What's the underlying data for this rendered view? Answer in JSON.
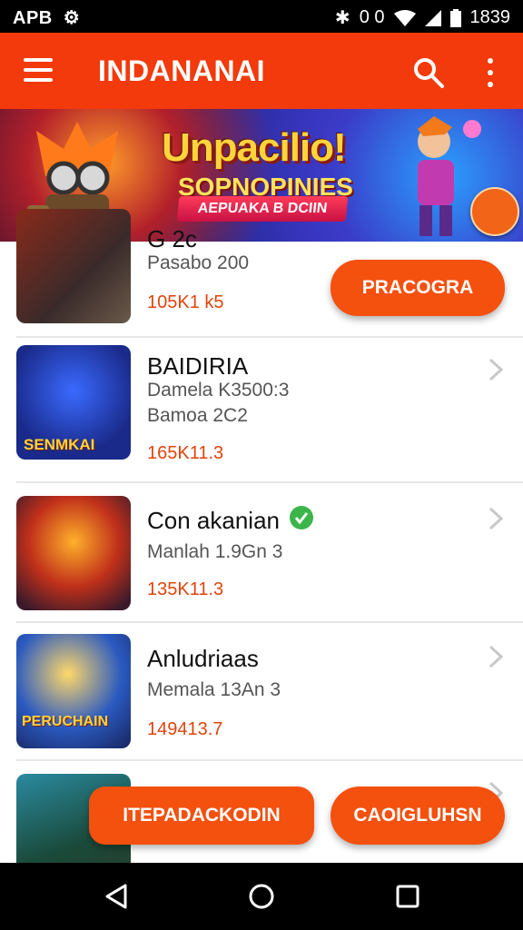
{
  "status_bar": {
    "left_text": "APB",
    "time": "1839",
    "battery_text": "0 0"
  },
  "app_bar": {
    "title": "INDANANAI"
  },
  "banner": {
    "title": "Unpacilio!",
    "subtitle": "SOPNOPINIES",
    "ribbon": "AEPUAKA B DCIIN"
  },
  "list": {
    "items": [
      {
        "title": "G  2c",
        "meta_1": "Pasabo  200",
        "meta_2": "",
        "rating": "105K1 k5",
        "verified": false,
        "thumb_text": ""
      },
      {
        "title": "BAIDIRIA",
        "meta_1": "Damela K3500:3",
        "meta_2": "Bamoa 2C2",
        "rating": "165K11.3",
        "verified": false,
        "thumb_text": "SENMKAI"
      },
      {
        "title": "Con akanian",
        "meta_1": "Manlah 1.9Gn 3",
        "meta_2": "",
        "rating": "135K11.3",
        "verified": true,
        "thumb_text": ""
      },
      {
        "title": "Anludriaas",
        "meta_1": "Memala  13An 3",
        "meta_2": "",
        "rating": "149413.7",
        "verified": false,
        "thumb_text": "PERUCHAIN"
      },
      {
        "title": "",
        "meta_1": "",
        "meta_2": "",
        "rating": "",
        "verified": false,
        "thumb_text": ""
      }
    ]
  },
  "buttons": {
    "install": "PRACOGRA",
    "bottom_left": "ITEPADACKODIN",
    "bottom_right": "CAOIGLUHSN"
  },
  "colors": {
    "primary": "#f23a0c",
    "accent": "#f4500e",
    "rating": "#e0440d"
  }
}
